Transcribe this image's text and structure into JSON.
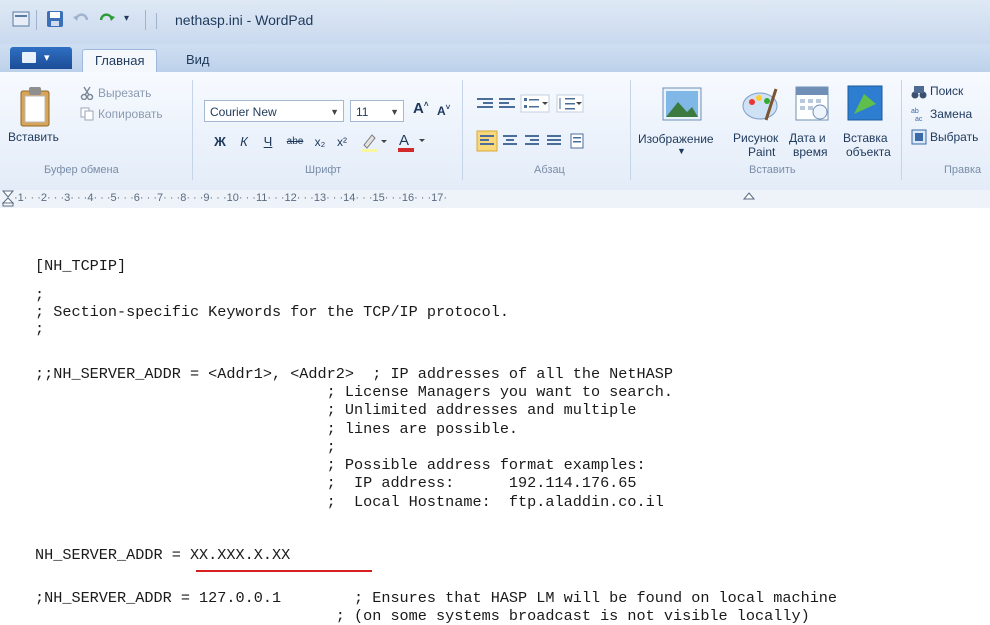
{
  "window": {
    "title": "nethasp.ini - WordPad"
  },
  "ribbon": {
    "tabs": [
      {
        "label": "Главная"
      },
      {
        "label": "Вид"
      }
    ],
    "clipboard": {
      "paste": "Вставить",
      "cut": "Вырезать",
      "copy": "Копировать",
      "group": "Буфер обмена"
    },
    "font": {
      "name": "Courier New",
      "size": "11",
      "bold": "Ж",
      "italic": "К",
      "underline": "Ч",
      "strike": "abe",
      "sub": "x₂",
      "sup": "x²",
      "group": "Шрифт"
    },
    "paragraph": {
      "group": "Абзац"
    },
    "insert": {
      "image": "Изображение",
      "paint_1": "Рисунок",
      "paint_2": "Paint",
      "datetime_1": "Дата и",
      "datetime_2": "время",
      "object_1": "Вставка",
      "object_2": "объекта",
      "group": "Вставить"
    },
    "editing": {
      "find": "Поиск",
      "replace": "Замена",
      "select": "Выбрать",
      "group": "Правка"
    }
  },
  "ruler": {
    "marks": "·1· · ·2· · ·3· · ·4· · ·5· · ·6· · ·7· · ·8· · ·9· · ·10· · ·11· · ·12· · ·13· · ·14· · ·15· · ·16· · ·17·"
  },
  "document": {
    "lines": [
      "[NH_TCPIP]",
      "",
      ";",
      "; Section-specific Keywords for the TCP/IP protocol.",
      ";",
      "",
      ";;NH_SERVER_ADDR = <Addr1>, <Addr2>  ; IP addresses of all the NetHASP",
      "                                ; License Managers you want to search.",
      "                                ; Unlimited addresses and multiple",
      "                                ; lines are possible.",
      "                                ;",
      "                                ; Possible address format examples:",
      "                                ;  IP address:      192.114.176.65",
      "                                ;  Local Hostname:  ftp.aladdin.co.il",
      "",
      "NH_SERVER_ADDR = XX.XXX.X.XX",
      "",
      ";NH_SERVER_ADDR = 127.0.0.1        ; Ensures that HASP LM will be found on local machine",
      "                                 ; (on some systems broadcast is not visible locally)"
    ]
  },
  "colors": {
    "accent": "#1c4d97",
    "underline": "#d62020"
  }
}
